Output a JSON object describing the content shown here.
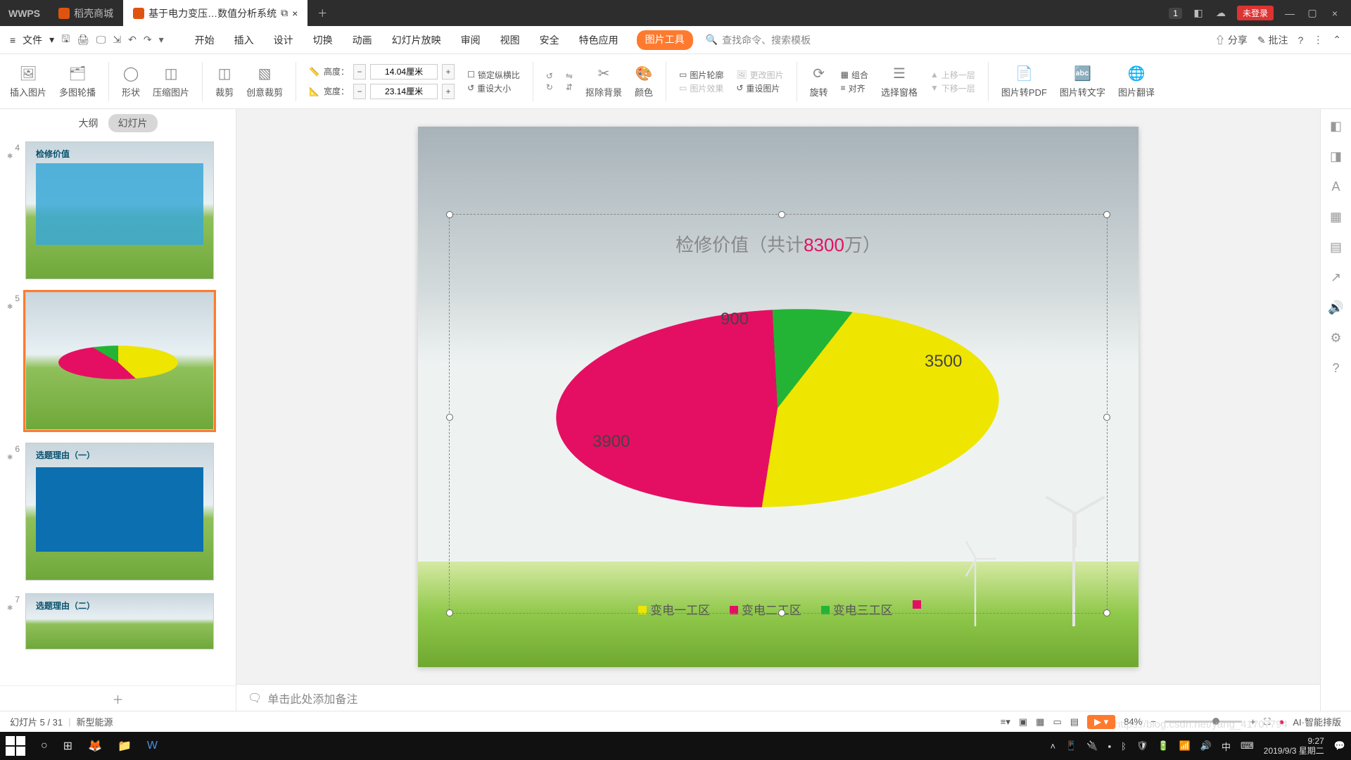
{
  "titlebar": {
    "app": "WPS",
    "tab_store": "稻壳商城",
    "tab_doc": "基于电力变压…数值分析系统",
    "badge": "1",
    "login": "未登录"
  },
  "menubar": {
    "file": "文件",
    "tabs": [
      "开始",
      "插入",
      "设计",
      "切换",
      "动画",
      "幻灯片放映",
      "审阅",
      "视图",
      "安全",
      "特色应用",
      "图片工具"
    ],
    "search_placeholder": "查找命令、搜索模板",
    "share": "分享",
    "comment": "批注"
  },
  "ribbon": {
    "insert_pic": "插入图片",
    "multi_carousel": "多图轮播",
    "shape": "形状",
    "compress": "压缩图片",
    "crop": "裁剪",
    "creative_crop": "创意裁剪",
    "height_label": "高度：",
    "height_value": "14.04厘米",
    "width_label": "宽度：",
    "width_value": "23.14厘米",
    "lock_ratio": "锁定纵横比",
    "reset_size": "重设大小",
    "remove_bg": "抠除背景",
    "color": "颜色",
    "pic_outline": "图片轮廓",
    "pic_effect": "图片效果",
    "change_pic": "更改图片",
    "reset_pic": "重设图片",
    "rotate": "旋转",
    "combine": "组合",
    "align": "对齐",
    "select_pane": "选择窗格",
    "up_layer": "上移一层",
    "down_layer": "下移一层",
    "pic_to_pdf": "图片转PDF",
    "pic_to_text": "图片转文字",
    "pic_translate": "图片翻译"
  },
  "sidepane": {
    "outline": "大纲",
    "slides": "幻灯片",
    "add": "＋",
    "items": [
      {
        "n": "4",
        "title": "检修价值"
      },
      {
        "n": "5",
        "title": ""
      },
      {
        "n": "6",
        "title": "选题理由（一）"
      },
      {
        "n": "7",
        "title": "选题理由（二）"
      }
    ]
  },
  "chart_data": {
    "type": "pie",
    "title_prefix": "检修价值（共计",
    "title_value": "8300",
    "title_suffix": "万）",
    "series": [
      {
        "name": "变电一工区",
        "value": 3500,
        "color": "#eee500"
      },
      {
        "name": "变电二工区",
        "value": 3900,
        "color": "#e40f63"
      },
      {
        "name": "变电三工区",
        "value": 900,
        "color": "#23b436"
      }
    ],
    "labels": {
      "a": "3500",
      "b": "3900",
      "c": "900"
    }
  },
  "notes": {
    "placeholder": "单击此处添加备注"
  },
  "statusbar": {
    "page": "幻灯片 5 / 31",
    "theme": "新型能源",
    "zoom": "84%",
    "ai": "AI·智能排版"
  },
  "taskbar": {
    "time": "9:27",
    "date": "2019/9/3 星期二"
  },
  "watermark": "https://blog.csdn.net/yang_41707794"
}
